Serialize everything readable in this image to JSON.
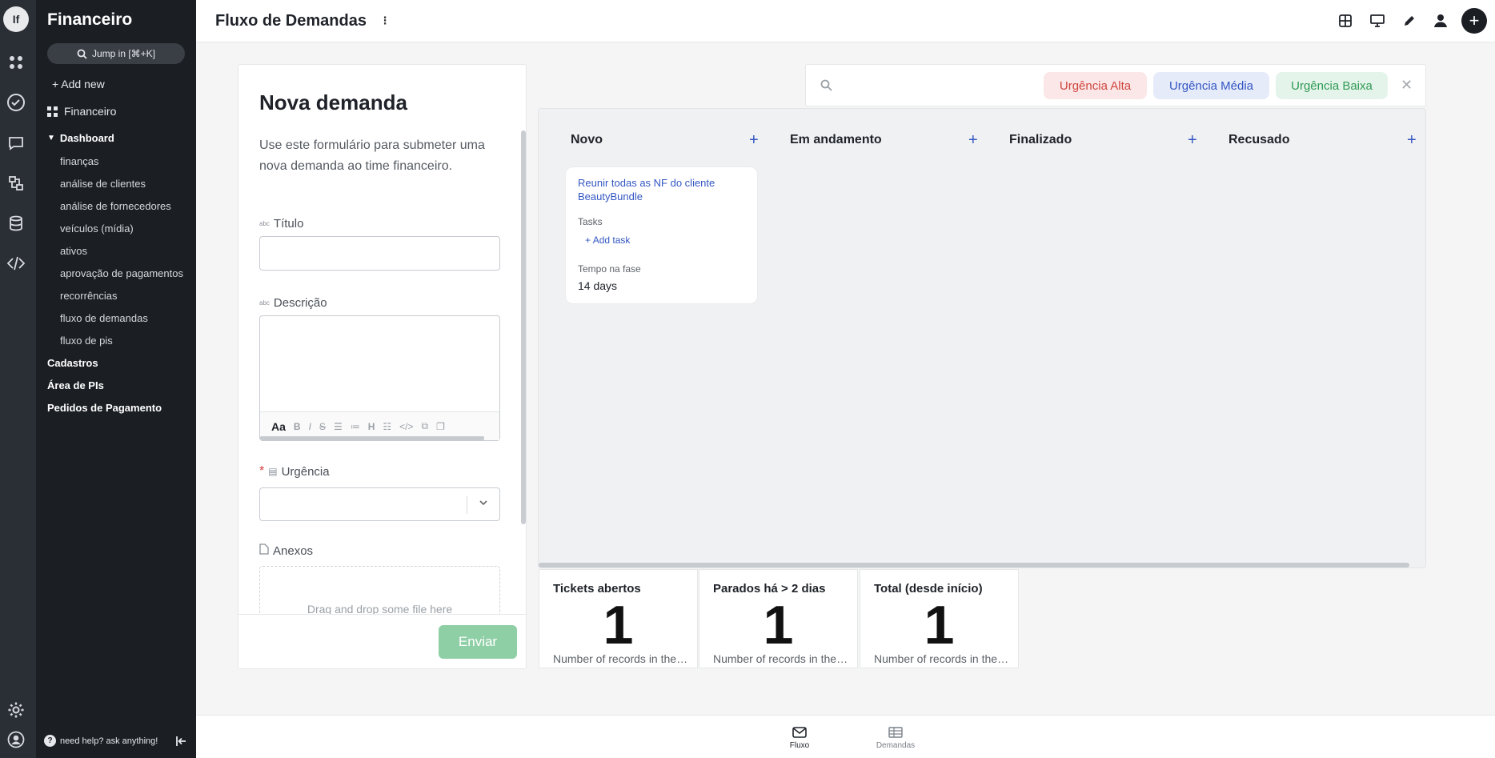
{
  "rail": {
    "logo": "If",
    "icons": [
      "apps-icon",
      "check-circle-icon",
      "chat-icon",
      "workflow-icon",
      "database-icon",
      "code-icon",
      "settings-icon",
      "profile-icon"
    ]
  },
  "sidebar": {
    "title": "Financeiro",
    "jump_label": "Jump in [⌘+K]",
    "add_new": "Add new",
    "app_label": "Financeiro",
    "dashboard_label": "Dashboard",
    "dashboard_items": [
      "finanças",
      "análise de clientes",
      "análise de fornecedores",
      "veículos (mídia)",
      "ativos",
      "aprovação de pagamentos",
      "recorrências",
      "fluxo de demandas",
      "fluxo de pis"
    ],
    "sections": [
      "Cadastros",
      "Área de PIs",
      "Pedidos de Pagamento"
    ],
    "help_text": "need help? ask anything!"
  },
  "topbar": {
    "title": "Fluxo de Demandas"
  },
  "form": {
    "title": "Nova demanda",
    "description": "Use este formulário para submeter uma nova demanda ao time financeiro.",
    "field_titulo": "Título",
    "field_descricao": "Descrição",
    "field_urgencia": "Urgência",
    "field_anexos": "Anexos",
    "field_type_text": "abc",
    "rte_format": "Aa",
    "dropzone": "Drag and drop some file here",
    "submit": "Enviar"
  },
  "filters": {
    "alta": "Urgência Alta",
    "media": "Urgência Média",
    "baixa": "Urgência Baixa"
  },
  "kanban": {
    "columns": [
      "Novo",
      "Em andamento",
      "Finalizado",
      "Recusado"
    ],
    "card": {
      "title": "Reunir todas as NF do cliente BeautyBundle",
      "tasks_label": "Tasks",
      "add_task": "Add task",
      "phase_label": "Tempo na fase",
      "phase_value": "14 days"
    }
  },
  "stats": [
    {
      "title": "Tickets abertos",
      "value": "1",
      "desc": "Number of records in the table"
    },
    {
      "title": "Parados há > 2 dias",
      "value": "1",
      "desc": "Number of records in the table"
    },
    {
      "title": "Total (desde início)",
      "value": "1",
      "desc": "Number of records in the table"
    }
  ],
  "bottomnav": {
    "fluxo": "Fluxo",
    "demandas": "Demandas"
  },
  "colors": {
    "accent": "#3356c2",
    "submit": "#8fcfa6",
    "rail": "#2a2f36",
    "sidebar": "#1b1f24"
  }
}
